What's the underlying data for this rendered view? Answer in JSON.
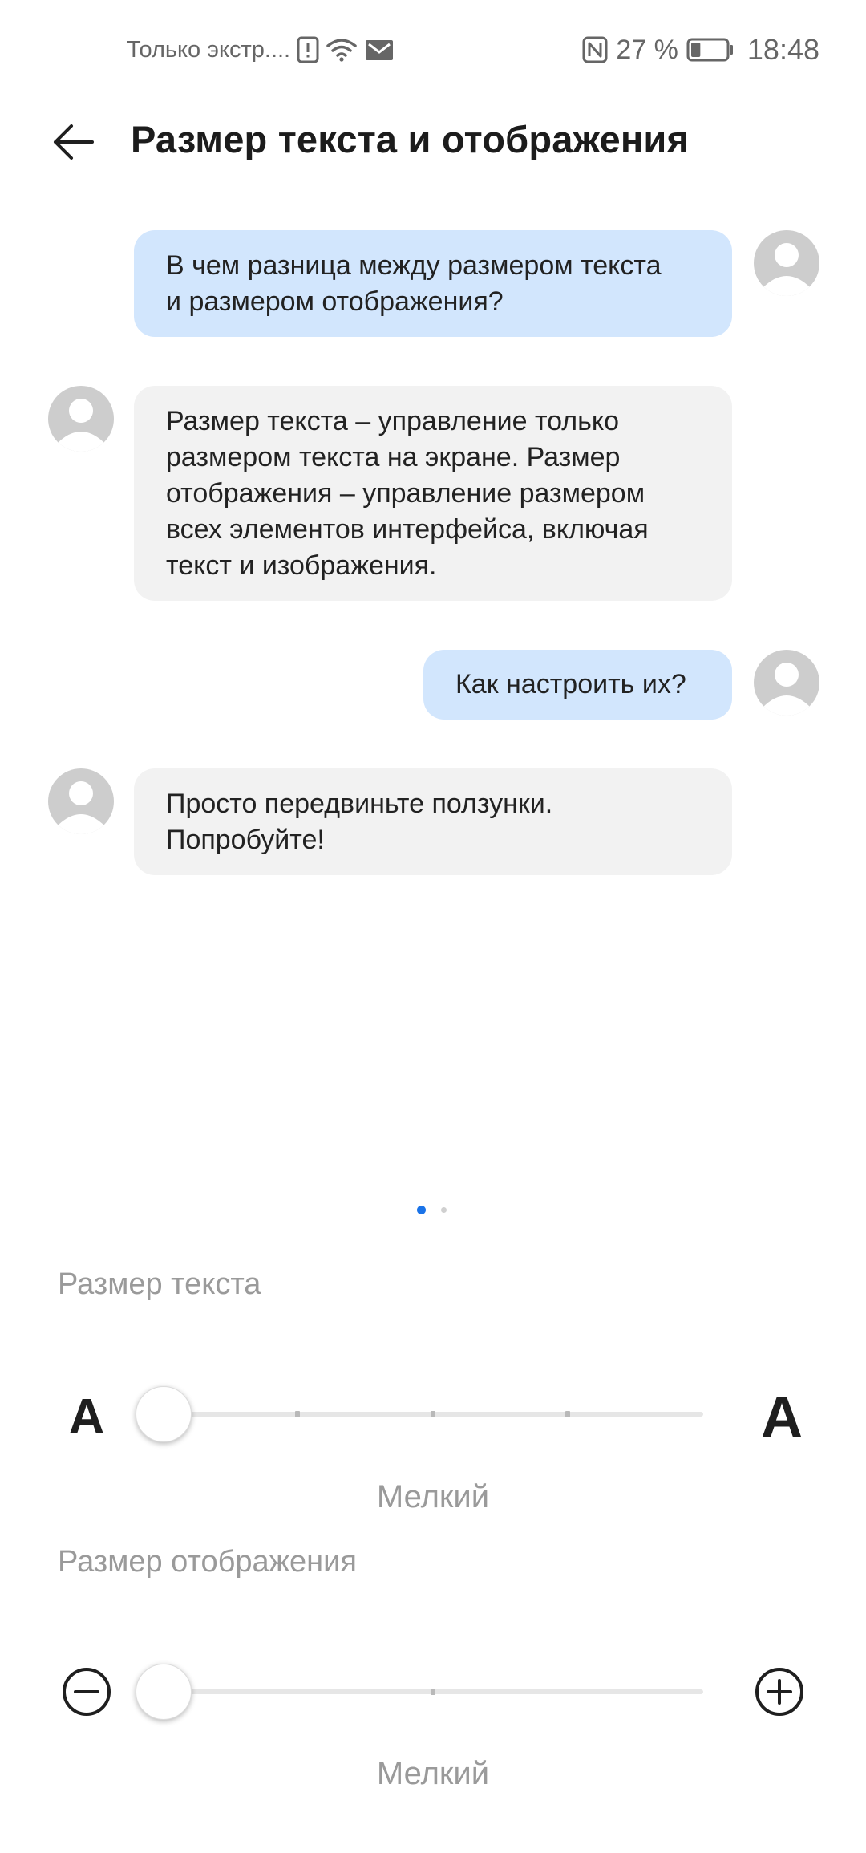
{
  "status_bar": {
    "notification_text": "Только экстр....",
    "battery_percent": "27 %",
    "time": "18:48",
    "battery_level": 0.27,
    "icons": [
      "alert-icon",
      "wifi-icon",
      "mail-icon",
      "nfc-icon",
      "battery-icon"
    ]
  },
  "app_bar": {
    "back_icon": "arrow-left-icon",
    "title": "Размер текста и отображения"
  },
  "chat": {
    "messages": [
      {
        "side": "out",
        "text": "В чем разница между размером текста\nи размером отображения?"
      },
      {
        "side": "in",
        "text": "Размер текста – управление только\nразмером текста на экране. Размер\nотображения – управление размером\nвсех элементов интерфейса, включая\nтекст и изображения."
      },
      {
        "side": "out",
        "text": "Как настроить их?"
      },
      {
        "side": "in",
        "text": "Просто передвиньте ползунки.\nПопробуйте!"
      }
    ],
    "avatar_icon": "person-icon"
  },
  "pager": {
    "pages": 2,
    "current": 1,
    "active_color": "#1a73e8",
    "inactive_color": "#d0d0d0"
  },
  "text_size": {
    "label": "Размер текста",
    "small_glyph": "A",
    "large_glyph": "A",
    "value_label": "Мелкий",
    "steps": 5,
    "current_step": 0
  },
  "display_size": {
    "label": "Размер отображения",
    "decrease_icon": "minus-circle-icon",
    "increase_icon": "plus-circle-icon",
    "value_label": "Мелкий",
    "steps": 3,
    "current_step": 0
  },
  "colors": {
    "outgoing_bubble": "#d2e6fd",
    "incoming_bubble": "#f2f2f2",
    "avatar": "#cdcdcd",
    "accent": "#1a73e8"
  }
}
